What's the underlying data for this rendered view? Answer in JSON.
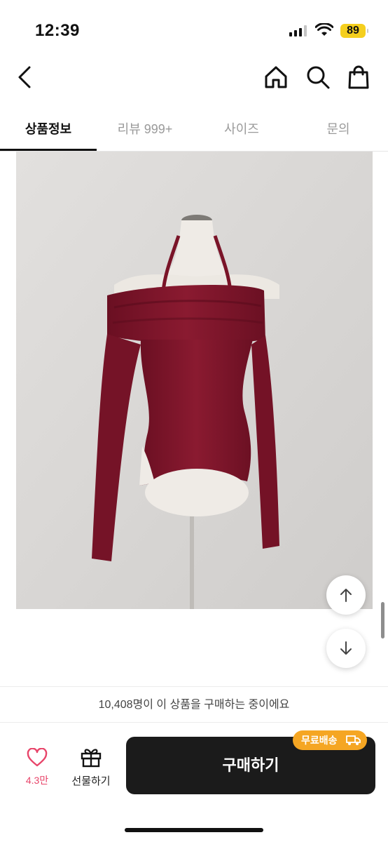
{
  "status_bar": {
    "time": "12:39",
    "battery": "89",
    "battery_color": "#f5cf1e"
  },
  "header": {
    "back_icon": "chevron-left-icon",
    "home_icon": "home-icon",
    "search_icon": "search-icon",
    "bag_icon": "shopping-bag-icon"
  },
  "tabs": [
    {
      "label": "상품정보",
      "active": true
    },
    {
      "label": "리뷰 999+",
      "active": false
    },
    {
      "label": "사이즈",
      "active": false
    },
    {
      "label": "문의",
      "active": false
    }
  ],
  "product": {
    "image_icon": "product-photo"
  },
  "viewer_banner": {
    "text": "10,408명이 이 상품을 구매하는 중이에요"
  },
  "bottom_bar": {
    "like_icon": "heart-icon",
    "like_count": "4.3만",
    "gift_icon": "gift-icon",
    "gift_label": "선물하기",
    "buy_label": "구매하기",
    "shipping_badge": "무료배송",
    "accent_color": "#e8456a",
    "badge_color": "#f5a623"
  }
}
